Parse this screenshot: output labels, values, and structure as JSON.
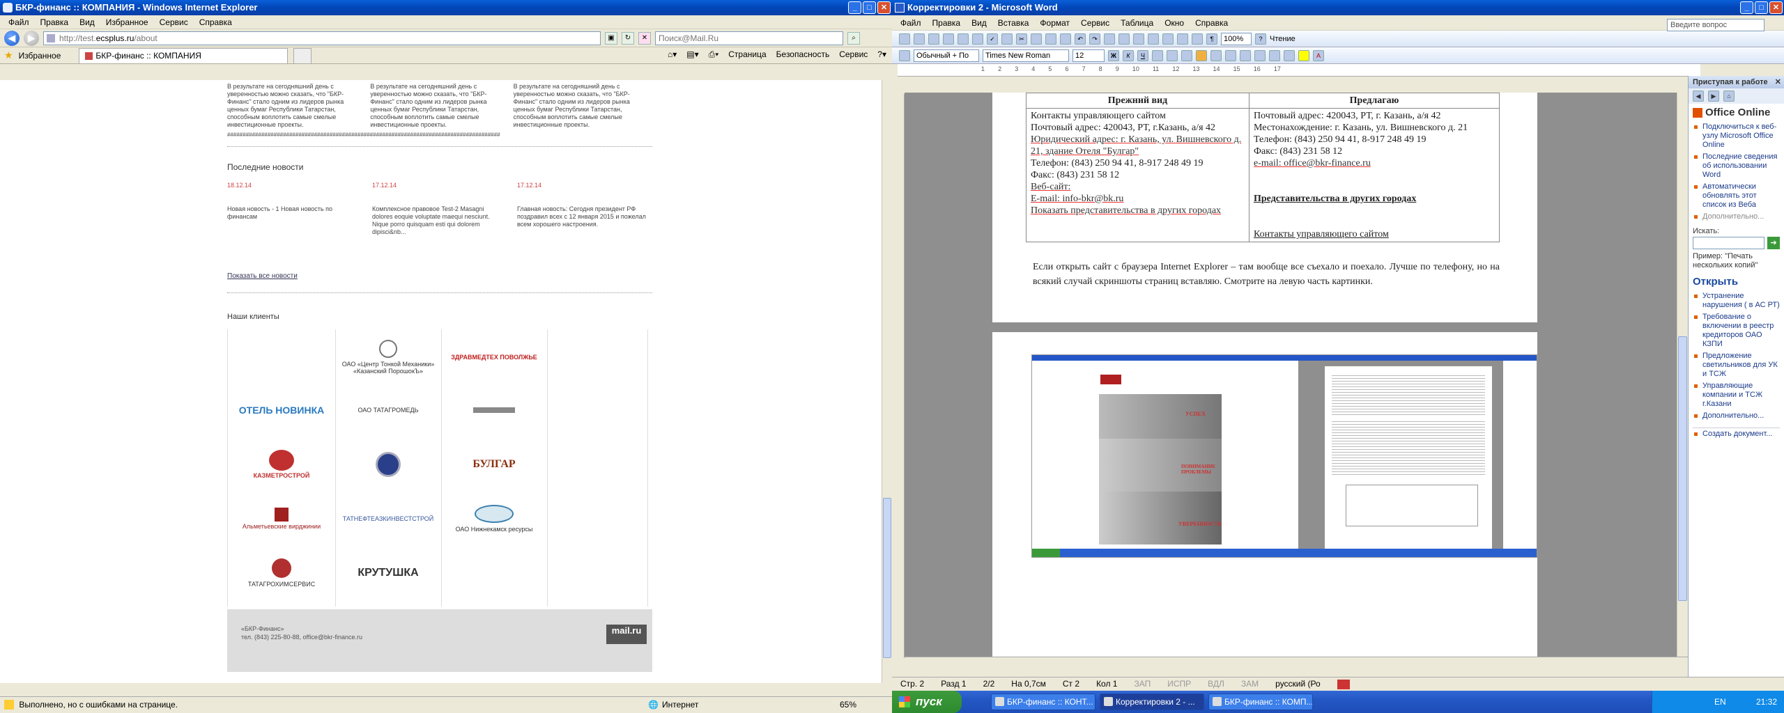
{
  "ie": {
    "title": "БКР-финанс :: КОМПАНИЯ - Windows Internet Explorer",
    "menu": [
      "Файл",
      "Правка",
      "Вид",
      "Избранное",
      "Сервис",
      "Справка"
    ],
    "address_prefix": "http://test.",
    "address_domain": "ecsplus.ru",
    "address_suffix": "/about",
    "search_placeholder": "Поиск@Mail.Ru",
    "favorites_label": "Избранное",
    "tab_label": "БКР-финанс :: КОМПАНИЯ",
    "tools": [
      "Страница",
      "Безопасность",
      "Сервис"
    ],
    "status_text": "Выполнено, но с ошибками на странице.",
    "zone": "Интернет",
    "zoom": "65%"
  },
  "site": {
    "top_paragraphs": [
      "В результате на сегодняшний день с уверенностью можно сказать, что \"БКР-Финанс\" стало одним из лидеров рынка ценных бумаг Республики Татарстан, способным воплотить самые смелые инвестиционные проекты.",
      "В результате на сегодняшний день с уверенностью можно сказать, что \"БКР-Финанс\" стало одним из лидеров рынка ценных бумаг Республики Татарстан, способным воплотить самые смелые инвестиционные проекты.",
      "В результате на сегодняшний день с уверенностью можно сказать, что \"БКР-Финанс\" стало одним из лидеров рынка ценных бумаг Республики Татарстан, способным воплотить самые смелые инвестиционные проекты."
    ],
    "hashes": "########################################################################################",
    "news_title": "Последние новости",
    "news": [
      {
        "date": "18.12.14",
        "text": "Новая новость - 1 Новая новость по финансам"
      },
      {
        "date": "17.12.14",
        "text": "Комплексное правовое Test-2 Masagni dolores eoquie voluptate maequi nesciunt. Nique porro quisquam esti qui dolorem dipisci&nb..."
      },
      {
        "date": "17.12.14",
        "text": "Главная новость: Сегодня президент РФ поздравил всех с 12 января 2015 и пожелал всем хорошего настроения."
      }
    ],
    "all_news_link": "Показать все новости",
    "clients_title": "Наши клиенты",
    "client_logos": [
      {
        "name": "ОАО «Центр Тонкой Механики» «Казанский ПорошокЪ»",
        "color": "#555"
      },
      {
        "name": "ЗДРАВМЕДТЕХ ПОВОЛЖЬЕ",
        "color": "#c02020"
      },
      {
        "name": "ОТЕЛЬ НОВИНКА",
        "color": "#2a7ac0"
      },
      {
        "name": "ОАО ТАТАГРОМЕДЬ",
        "color": "#444"
      },
      {
        "name": "",
        "color": "#888"
      },
      {
        "name": "КАЗМЕТРОСТРОЙ",
        "color": "#c03030"
      },
      {
        "name": "",
        "color": "#2a3f8a"
      },
      {
        "name": "БУЛГАР",
        "color": "#8a3010"
      },
      {
        "name": "Альметьевские вирджинии",
        "color": "#a02020"
      },
      {
        "name": "ТАТНЕФТЕАЗКИНВЕСТСТРОЙ",
        "color": "#3a5aa0"
      },
      {
        "name": "ОАО Нижнекамск ресурсы",
        "color": "#3a80b0"
      },
      {
        "name": "ТАТАГРОХИМСЕРВИС",
        "color": "#6a6a20"
      },
      {
        "name": "КРУТУШКА",
        "color": "#333"
      }
    ],
    "footer_company": "«БКР-Финанс»",
    "footer_contacts": "тел. (843) 225-80-88, office@bkr-finance.ru",
    "footer_badge": "mail.ru"
  },
  "word": {
    "title": "Корректировки 2 - Microsoft Word",
    "menu": [
      "Файл",
      "Правка",
      "Вид",
      "Вставка",
      "Формат",
      "Сервис",
      "Таблица",
      "Окно",
      "Справка"
    ],
    "help_placeholder": "Введите вопрос",
    "style": "Обычный + По",
    "font": "Times New Roman",
    "size": "12",
    "zoom": "100%",
    "reading_label": "Чтение",
    "ruler_numbers": [
      "1",
      "2",
      "3",
      "4",
      "5",
      "6",
      "7",
      "8",
      "9",
      "10",
      "11",
      "12",
      "13",
      "14",
      "15",
      "16",
      "17"
    ],
    "table": {
      "col1_header": "Прежний вид",
      "col2_header": "Предлагаю",
      "col1_lines": [
        "Контакты управляющего сайтом",
        "Почтовый адрес: 420043, РТ, г.Казань, а/я 42",
        "Юридический адрес: г. Казань, ул. Вишневского д. 21, здание Отеля \"Булгар\"",
        "Телефон: (843) 250 94 41, 8-917 248 49 19",
        "Факс: (843) 231 58 12",
        "Веб-сайт:",
        "E-mail: info-bkr@bk.ru",
        "Показать представительства в других городах"
      ],
      "col2_lines": [
        "Почтовый адрес: 420043, РТ, г. Казань, а/я 42",
        "Местонахождение: г. Казань, ул. Вишневского д. 21",
        "Телефон: (843) 250 94 41, 8-917 248 49 19",
        "Факс: (843) 231 58 12",
        "e-mail: office@bkr-finance.ru",
        "Представительства в других городах",
        "Контакты управляющего сайтом"
      ]
    },
    "body_text": "Если открыть сайт с браузера Internet Explorer – там вообще все съехало и поехало. Лучше по телефону, но на всякий случай скриншоты страниц вставляю. Смотрите на левую часть картинки.",
    "thumb_banners": [
      "УСПЕХ",
      "ПОНИМАНИЕ ПРОБЛЕМЫ",
      "УВЕРЕННОСТЬ"
    ],
    "status": [
      "Стр. 2",
      "Разд 1",
      "2/2",
      "На 0,7см",
      "Ст 2",
      "Кол 1",
      "ЗАП",
      "ИСПР",
      "ВДЛ",
      "ЗАМ",
      "русский (Ро"
    ],
    "taskpane": {
      "header": "Приступая к работе",
      "office_online": "Office Online",
      "links": [
        "Подключиться к веб-узлу Microsoft Office Online",
        "Последние сведения об использовании Word",
        "Автоматически обновлять этот список из Веба"
      ],
      "more": "Дополнительно...",
      "search_label": "Искать:",
      "example": "Пример: \"Печать нескольких копий\"",
      "open_title": "Открыть",
      "open_links": [
        "Устранение нарушения ( в АС РТ)",
        "Требование о включении в реестр кредиторов ОАО КЗПИ",
        "Предложение светильников для УК и ТСЖ",
        "Управляющие компании и ТСЖ г.Казани"
      ],
      "open_more": "Дополнительно...",
      "create": "Создать документ..."
    }
  },
  "taskbar": {
    "start": "пуск",
    "tasks": [
      "БКР-финанс :: КОНТ...",
      "Корректировки 2 - ...",
      "БКР-финанс :: КОМП..."
    ],
    "lang": "EN",
    "clock": "21:32"
  }
}
